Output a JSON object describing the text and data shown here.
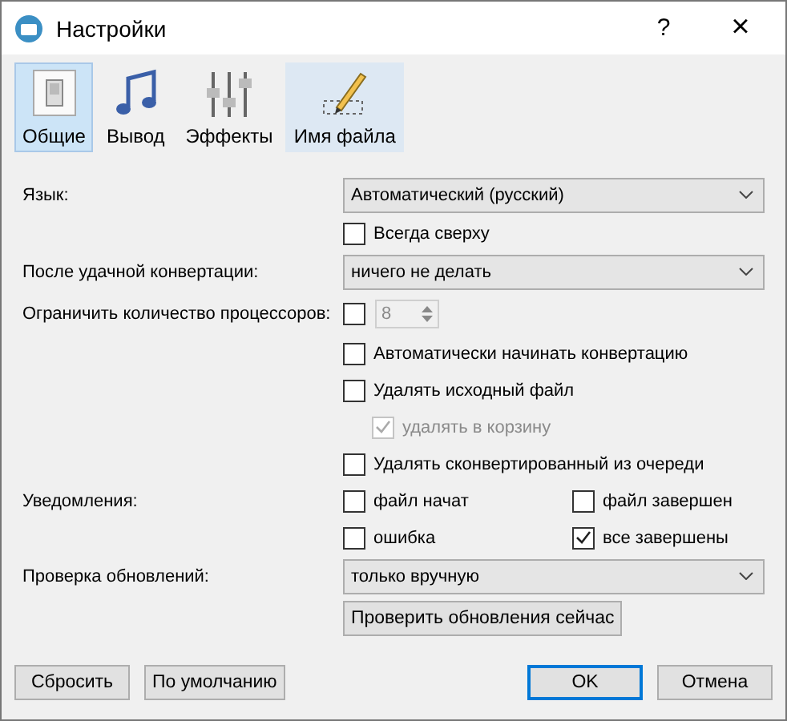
{
  "window": {
    "title": "Настройки",
    "help": "?",
    "close": "×"
  },
  "tabs": [
    {
      "label": "Общие",
      "kind": "switch",
      "selected": true,
      "hovered": false
    },
    {
      "label": "Вывод",
      "kind": "note",
      "selected": false,
      "hovered": false
    },
    {
      "label": "Эффекты",
      "kind": "sliders",
      "selected": false,
      "hovered": false
    },
    {
      "label": "Имя файла",
      "kind": "pencil",
      "selected": false,
      "hovered": true
    }
  ],
  "rows": [
    {
      "kind": "select",
      "label": "Язык:",
      "value": "Автоматический (русский)"
    },
    {
      "kind": "check",
      "options": [
        {
          "label": "Всегда сверху",
          "checked": false,
          "disabled": false
        }
      ]
    },
    {
      "kind": "select",
      "label": "После удачной конвертации:",
      "value": "ничего не делать"
    },
    {
      "kind": "spin",
      "label": "Ограничить количество процессоров:",
      "checked": false,
      "value": "8",
      "disabled": true
    },
    {
      "kind": "check",
      "options": [
        {
          "label": "Автоматически начинать конвертацию",
          "checked": false,
          "disabled": false
        }
      ]
    },
    {
      "kind": "check",
      "options": [
        {
          "label": "Удалять исходный файл",
          "checked": false,
          "disabled": false
        }
      ]
    },
    {
      "kind": "subcheck",
      "options": [
        {
          "label": "удалять в корзину",
          "checked": true,
          "disabled": true
        }
      ]
    },
    {
      "kind": "check",
      "options": [
        {
          "label": "Удалять сконвертированный из очереди",
          "checked": false,
          "disabled": false
        }
      ]
    },
    {
      "kind": "check",
      "label": "Уведомления:",
      "options": [
        {
          "label": "файл начат",
          "checked": false,
          "disabled": false
        },
        {
          "label": "файл завершен",
          "checked": false,
          "disabled": false
        }
      ]
    },
    {
      "kind": "check",
      "options": [
        {
          "label": "ошибка",
          "checked": false,
          "disabled": false
        },
        {
          "label": "все завершены",
          "checked": true,
          "disabled": false
        }
      ]
    },
    {
      "kind": "select",
      "label": "Проверка обновлений:",
      "value": "только вручную"
    },
    {
      "kind": "button",
      "label": "Проверить обновления сейчас"
    }
  ],
  "footer": {
    "left": [
      {
        "label": "Сбросить",
        "default": false
      },
      {
        "label": "По умолчанию",
        "default": false
      }
    ],
    "right": [
      {
        "label": "OK",
        "default": true
      },
      {
        "label": "Отмена",
        "default": false
      }
    ]
  }
}
